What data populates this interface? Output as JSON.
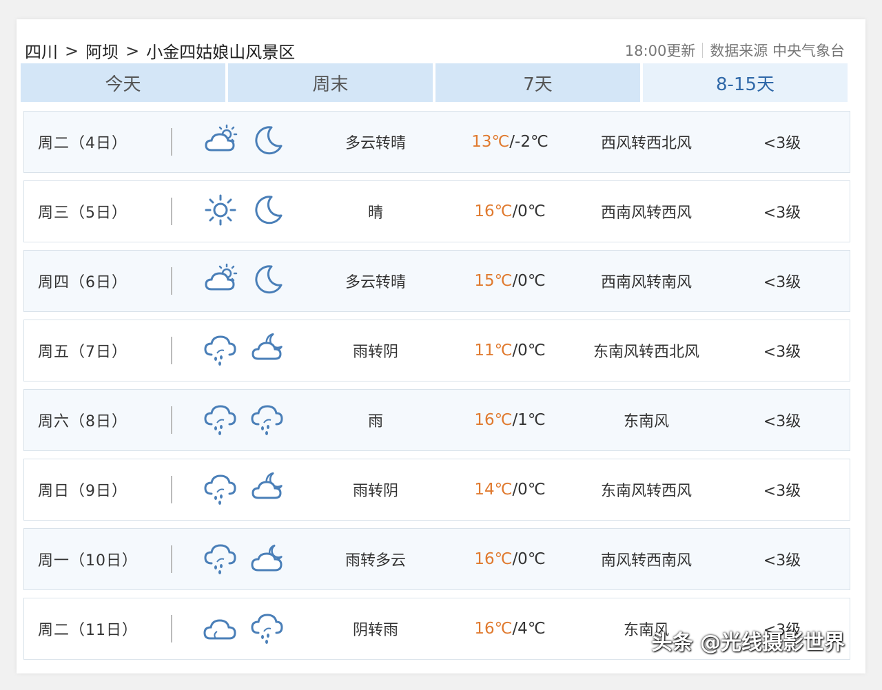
{
  "breadcrumb": {
    "province": "四川",
    "city": "阿坝",
    "place": "小金四姑娘山风景区",
    "separator": ">"
  },
  "source": {
    "update": "18:00更新",
    "label": "数据来源 中央气象台"
  },
  "tabs": [
    {
      "label": "今天"
    },
    {
      "label": "周末"
    },
    {
      "label": "7天"
    },
    {
      "label": "8-15天",
      "active": true
    }
  ],
  "days": [
    {
      "day": "周二（4日）",
      "day_icon": "partly-cloudy-sun-icon",
      "night_icon": "moon-icon",
      "weather": "多云转晴",
      "high": "13℃",
      "low": "/-2℃",
      "wind": "西风转西北风",
      "level": "<3级"
    },
    {
      "day": "周三（5日）",
      "day_icon": "sun-icon",
      "night_icon": "moon-icon",
      "weather": "晴",
      "high": "16℃",
      "low": "/0℃",
      "wind": "西南风转西风",
      "level": "<3级"
    },
    {
      "day": "周四（6日）",
      "day_icon": "partly-cloudy-sun-icon",
      "night_icon": "moon-icon",
      "weather": "多云转晴",
      "high": "15℃",
      "low": "/0℃",
      "wind": "西南风转南风",
      "level": "<3级"
    },
    {
      "day": "周五（7日）",
      "day_icon": "rain-icon",
      "night_icon": "cloudy-night-icon",
      "weather": "雨转阴",
      "high": "11℃",
      "low": "/0℃",
      "wind": "东南风转西北风",
      "level": "<3级"
    },
    {
      "day": "周六（8日）",
      "day_icon": "rain-icon",
      "night_icon": "rain-icon",
      "weather": "雨",
      "high": "16℃",
      "low": "/1℃",
      "wind": "东南风",
      "level": "<3级"
    },
    {
      "day": "周日（9日）",
      "day_icon": "rain-icon",
      "night_icon": "cloudy-night-icon",
      "weather": "雨转阴",
      "high": "14℃",
      "low": "/0℃",
      "wind": "东南风转西风",
      "level": "<3级"
    },
    {
      "day": "周一（10日）",
      "day_icon": "rain-icon",
      "night_icon": "partly-cloudy-night-icon",
      "weather": "雨转多云",
      "high": "16℃",
      "low": "/0℃",
      "wind": "南风转西南风",
      "level": "<3级"
    },
    {
      "day": "周二（11日）",
      "day_icon": "cloud-icon",
      "night_icon": "rain-icon",
      "weather": "阴转雨",
      "high": "16℃",
      "low": "/4℃",
      "wind": "东南风",
      "level": "<3级"
    }
  ],
  "watermark": "头条 @光线摄影世界",
  "colors": {
    "tab_bg": "#d4e6f7",
    "tab_active_text": "#2f68a8",
    "high_temp": "#e07a2f",
    "icon_stroke": "#4a7fb8"
  }
}
